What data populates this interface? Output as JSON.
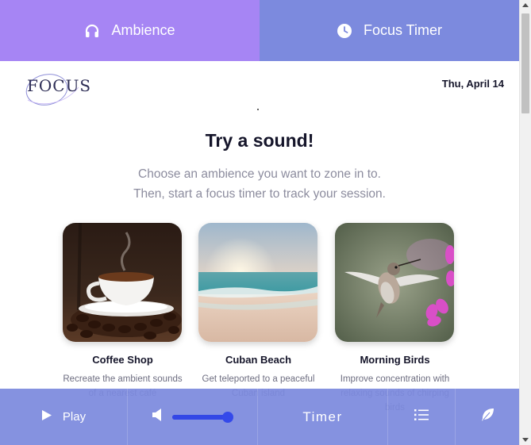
{
  "tabs": {
    "ambience": {
      "label": "Ambience",
      "icon": "headphones-icon"
    },
    "focus": {
      "label": "Focus Timer",
      "icon": "clock-icon"
    }
  },
  "header": {
    "logo_text": "FOCUS",
    "date": "Thu, April 14"
  },
  "main": {
    "headline": "Try a sound!",
    "subtitle_line1": "Choose an ambience you want to zone in to.",
    "subtitle_line2": "Then, start a focus timer to track your session."
  },
  "cards": [
    {
      "name": "Coffee Shop",
      "desc": "Recreate the ambient sounds of a nearest café",
      "image": "coffee-cup-image"
    },
    {
      "name": "Cuban Beach",
      "desc": "Get teleported to a peaceful Cuban island",
      "image": "beach-sunset-image"
    },
    {
      "name": "Morning Birds",
      "desc": "Improve concentration with relaxing sounds of chirping birds",
      "image": "hummingbird-image"
    }
  ],
  "player": {
    "play_label": "Play",
    "timer_label": "Timer",
    "volume_level": 0.95
  },
  "colors": {
    "ambience_tab": "#a685f4",
    "focus_tab": "#7c8ade",
    "player_bar": "#7c8ade",
    "slider": "#3449ea"
  }
}
